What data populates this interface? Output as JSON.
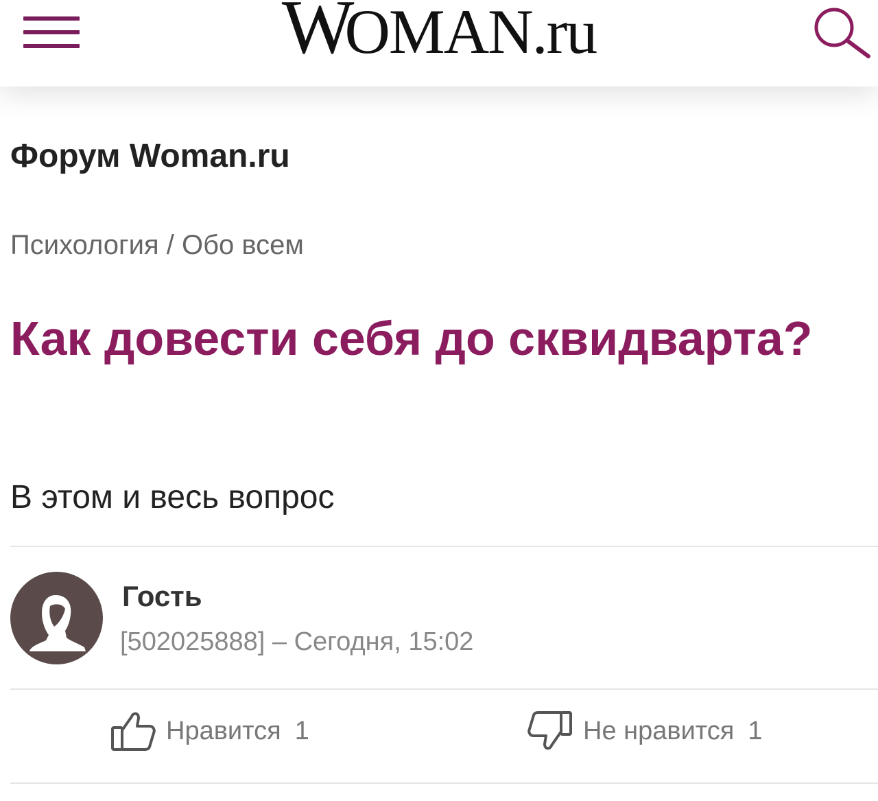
{
  "header": {
    "logo_first": "W",
    "logo_rest": "OMAN.ru",
    "menu_icon": "hamburger-icon",
    "search_icon": "search-icon"
  },
  "forum": {
    "title": "Форум Woman.ru",
    "breadcrumb": "Психология / Обо всем"
  },
  "post": {
    "title": "Как довести себя до сквидварта?",
    "body": "В этом и весь вопрос"
  },
  "author": {
    "name": "Гость",
    "meta": "[502025888] – Сегодня, 15:02",
    "avatar_icon": "user-silhouette-icon"
  },
  "votes": {
    "like_label": "Нравится",
    "like_count": "1",
    "like_icon": "thumbs-up-icon",
    "dislike_label": "Не нравится",
    "dislike_count": "1",
    "dislike_icon": "thumbs-down-icon"
  },
  "colors": {
    "accent": "#8b1d5f",
    "menu": "#7a1d5c",
    "avatar_bg": "#5a4a4a"
  }
}
